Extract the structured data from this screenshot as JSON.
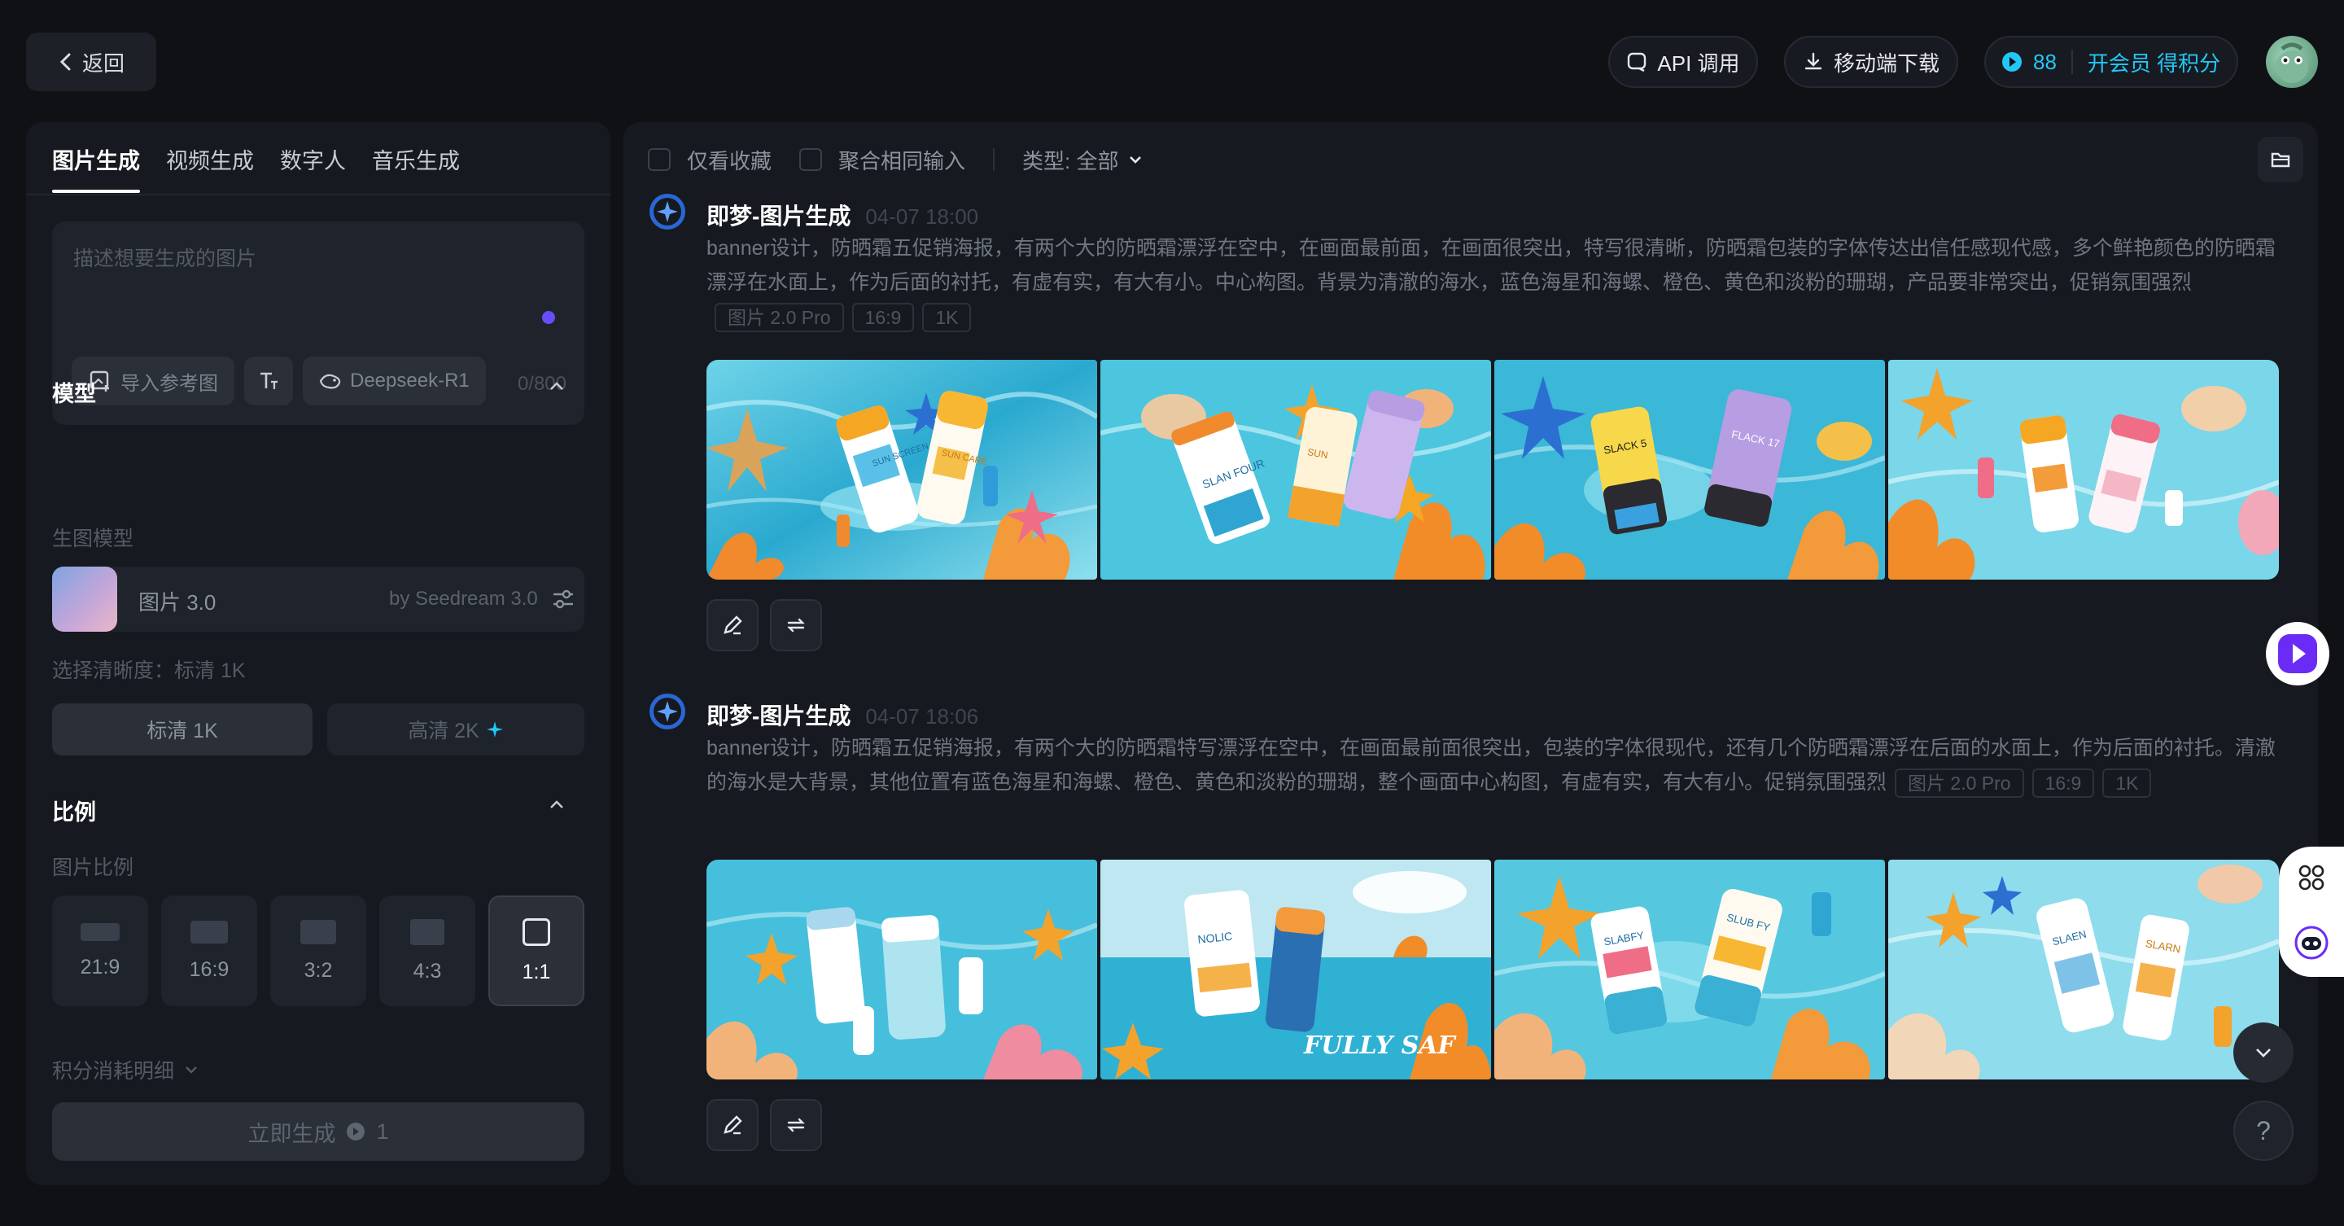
{
  "header": {
    "back_label": "返回",
    "api_label": "API 调用",
    "mobile_label": "移动端下载",
    "credits": "88",
    "vip_label": "开会员 得积分"
  },
  "left": {
    "tabs": [
      {
        "label": "图片生成",
        "active": true
      },
      {
        "label": "视频生成",
        "active": false
      },
      {
        "label": "数字人",
        "active": false
      },
      {
        "label": "音乐生成",
        "active": false
      }
    ],
    "prompt_placeholder": "描述想要生成的图片",
    "import_ref_label": "导入参考图",
    "deepseek_label": "Deepseek-R1",
    "char_count": "0/800",
    "model_section": "模型",
    "model_sub": "生图模型",
    "model_name": "图片 3.0",
    "model_by": "by Seedream 3.0",
    "res_label": "选择清晰度：标清 1K",
    "res_1k": "标清 1K",
    "res_2k": "高清 2K",
    "ratio_section": "比例",
    "ratio_sub": "图片比例",
    "ratios": [
      "21:9",
      "16:9",
      "3:2",
      "4:3",
      "1:1"
    ],
    "cost_label": "积分消耗明细",
    "generate_label": "立即生成",
    "generate_cost": "1"
  },
  "right": {
    "fav_only": "仅看收藏",
    "merge_same": "聚合相同输入",
    "type_filter": "类型: 全部",
    "records": [
      {
        "title": "即梦-图片生成",
        "time": "04-07 18:00",
        "prompt": "banner设计，防晒霜五促销海报，有两个大的防晒霜漂浮在空中，在画面最前面，在画面很突出，特写很清晰，防晒霜包装的字体传达出信任感现代感，多个鲜艳颜色的防晒霜漂浮在水面上，作为后面的衬托，有虚有实，有大有小。中心构图。背景为清澈的海水，蓝色海星和海螺、橙色、黄色和淡粉的珊瑚，产品要非常突出，促销氛围强烈",
        "tags": [
          "图片 2.0 Pro",
          "16:9",
          "1K"
        ],
        "images": [
          {
            "products": [
              "SUN SCREEN",
              "SUN CARE"
            ]
          },
          {
            "products": [
              "SLAN FOUR",
              "SUN"
            ]
          },
          {
            "products": [
              "SLACK 5",
              "FLACK 17"
            ]
          },
          {
            "products": [
              "",
              ""
            ]
          }
        ]
      },
      {
        "title": "即梦-图片生成",
        "time": "04-07 18:06",
        "prompt": "banner设计，防晒霜五促销海报，有两个大的防晒霜特写漂浮在空中，在画面最前面很突出，包装的字体很现代，还有几个防晒霜漂浮在后面的水面上，作为后面的衬托。清澈的海水是大背景，其他位置有蓝色海星和海螺、橙色、黄色和淡粉的珊瑚，整个画面中心构图，有虚有实，有大有小。促销氛围强烈",
        "tags": [
          "图片 2.0 Pro",
          "16:9",
          "1K"
        ],
        "images": [
          {
            "products": [
              "",
              ""
            ]
          },
          {
            "products": [
              "NOLIC",
              "FULLY SAF"
            ]
          },
          {
            "products": [
              "SLABFY",
              "SLUB FY"
            ]
          },
          {
            "products": [
              "SLAEN",
              "SLARN"
            ]
          }
        ]
      }
    ]
  },
  "colors": {
    "accent": "#22c7f5",
    "panel": "#16191f",
    "bg": "#0f1115"
  }
}
